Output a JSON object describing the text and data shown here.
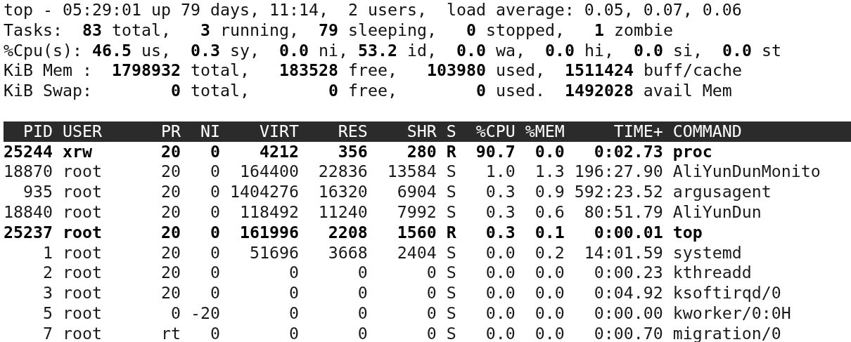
{
  "summary": [
    "top - 05:29:01 up 79 days, 11:14,  2 users,  load average: 0.05, 0.07, 0.06",
    "Tasks:  **83** total,   **3** running,  **79** sleeping,   **0** stopped,   **1** zombie",
    "%Cpu(s): **46.5** us,  **0.3** sy,  **0.0** ni, **53.2** id,  **0.0** wa,  **0.0** hi,  **0.0** si,  **0.0** st",
    "KiB Mem :  **1798932** total,   **183528** free,   **103980** used,  **1511424** buff/cache",
    "KiB Swap:        **0** total,        **0** free,        **0** used.  **1492028** avail Mem"
  ],
  "table": {
    "columns": [
      "PID",
      "USER",
      "PR",
      "NI",
      "VIRT",
      "RES",
      "SHR",
      "S",
      "%CPU",
      "%MEM",
      "TIME+",
      "COMMAND"
    ],
    "rows": [
      {
        "highlighted": true,
        "cells": [
          "25244",
          "xrw",
          "20",
          "0",
          "4212",
          "356",
          "280",
          "R",
          "90.7",
          "0.0",
          "0:02.73",
          "proc"
        ]
      },
      {
        "highlighted": false,
        "cells": [
          "18870",
          "root",
          "20",
          "0",
          "164400",
          "22836",
          "13584",
          "S",
          "1.0",
          "1.3",
          "196:27.90",
          "AliYunDunMonito"
        ]
      },
      {
        "highlighted": false,
        "cells": [
          "935",
          "root",
          "20",
          "0",
          "1404276",
          "16320",
          "6904",
          "S",
          "0.3",
          "0.9",
          "592:23.52",
          "argusagent"
        ]
      },
      {
        "highlighted": false,
        "cells": [
          "18840",
          "root",
          "20",
          "0",
          "118492",
          "11240",
          "7992",
          "S",
          "0.3",
          "0.6",
          "80:51.79",
          "AliYunDun"
        ]
      },
      {
        "highlighted": true,
        "cells": [
          "25237",
          "root",
          "20",
          "0",
          "161996",
          "2208",
          "1560",
          "R",
          "0.3",
          "0.1",
          "0:00.01",
          "top"
        ]
      },
      {
        "highlighted": false,
        "cells": [
          "1",
          "root",
          "20",
          "0",
          "51696",
          "3668",
          "2404",
          "S",
          "0.0",
          "0.2",
          "14:01.59",
          "systemd"
        ]
      },
      {
        "highlighted": false,
        "cells": [
          "2",
          "root",
          "20",
          "0",
          "0",
          "0",
          "0",
          "S",
          "0.0",
          "0.0",
          "0:00.23",
          "kthreadd"
        ]
      },
      {
        "highlighted": false,
        "cells": [
          "3",
          "root",
          "20",
          "0",
          "0",
          "0",
          "0",
          "S",
          "0.0",
          "0.0",
          "0:04.92",
          "ksoftirqd/0"
        ]
      },
      {
        "highlighted": false,
        "cells": [
          "5",
          "root",
          "0",
          "-20",
          "0",
          "0",
          "0",
          "S",
          "0.0",
          "0.0",
          "0:00.00",
          "kworker/0:0H"
        ]
      },
      {
        "highlighted": false,
        "cells": [
          "7",
          "root",
          "rt",
          "0",
          "0",
          "0",
          "0",
          "S",
          "0.0",
          "0.0",
          "0:00.70",
          "migration/0"
        ]
      }
    ]
  }
}
